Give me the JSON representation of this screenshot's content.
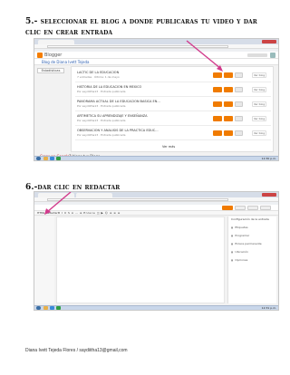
{
  "step5": {
    "heading": "5.- seleccionar el blog a donde publicaras tu video y dar clic en crear entrada",
    "screenshot": {
      "app_name": "Blogger",
      "blog_title": "Blog de Diana Ivett Tejeda",
      "side_button": "Estadísticas",
      "posts": [
        {
          "title": "LACTIC DE LA EDUCACION",
          "meta": "7 entradas · Última: 1 de mayo"
        },
        {
          "title": "HISTORIA DE LA EDUCACION EN MEXICO",
          "meta": "Por saydiitha13 · Entrada publicada"
        },
        {
          "title": "PANORAMA ACTUAL DE LA EDUCACION BASICA EN...",
          "meta": "Por saydiitha13 · Entrada publicada"
        },
        {
          "title": "ARTIMETICA SU APRENDIZAJE Y ENSEÑANZA",
          "meta": "Por saydiitha13 · Entrada publicada"
        },
        {
          "title": "OBSERVACION Y ANALISIS DE LA PRACTICA EDUC...",
          "meta": "Por saydiitha13 · Entrada publicada"
        }
      ],
      "share_label": "Ver blog",
      "more_link": "Ver más",
      "gplus_label": "Crear en Google+",
      "gplus_text": "7 blogs tus Blogs",
      "clock": "12:30 p.m."
    }
  },
  "step6": {
    "heading": "6.-dar clic en redactar",
    "screenshot": {
      "editor_tab": "HTML Redactar",
      "tools": "B I U S A ⋯ ≡ Enlace ◫ ▶ ☺ ≡ ≡ ≡",
      "panel_title": "Configuración de la entrada",
      "settings": [
        "Etiquetas",
        "Programar",
        "Enlace permanente",
        "Ubicación",
        "Opciones"
      ],
      "clock": "12:31 p.m."
    }
  },
  "footer": "Diana Ivett Tejeda Flores / saydiitha13@gmail,com",
  "colors": {
    "blogger_orange": "#f07b00",
    "arrow": "#d23a8c"
  }
}
